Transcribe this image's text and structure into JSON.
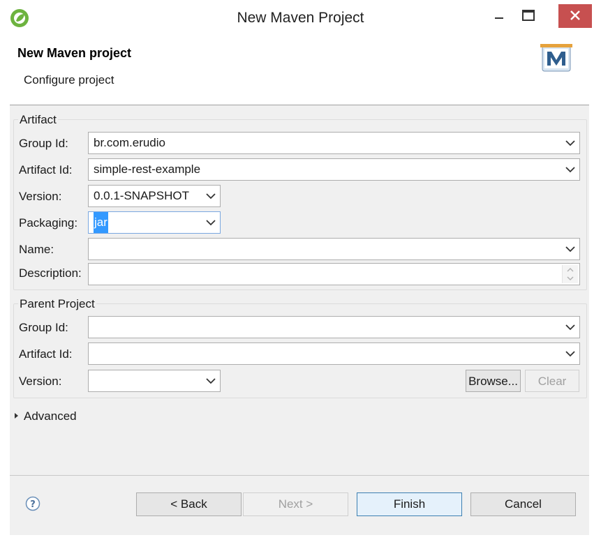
{
  "window": {
    "title": "New Maven Project"
  },
  "header": {
    "title": "New Maven project",
    "subtitle": "Configure project"
  },
  "artifact": {
    "legend": "Artifact",
    "group_id": {
      "label": "Group Id:",
      "value": "br.com.erudio"
    },
    "artifact_id": {
      "label": "Artifact Id:",
      "value": "simple-rest-example"
    },
    "version": {
      "label": "Version:",
      "value": "0.0.1-SNAPSHOT"
    },
    "packaging": {
      "label": "Packaging:",
      "value": "jar"
    },
    "name": {
      "label": "Name:",
      "value": ""
    },
    "description": {
      "label": "Description:",
      "value": ""
    }
  },
  "parent": {
    "legend": "Parent Project",
    "group_id": {
      "label": "Group Id:",
      "value": ""
    },
    "artifact_id": {
      "label": "Artifact Id:",
      "value": ""
    },
    "version": {
      "label": "Version:",
      "value": ""
    },
    "browse_label": "Browse...",
    "clear_label": "Clear"
  },
  "advanced": {
    "label": "Advanced"
  },
  "footer": {
    "back_label": "< Back",
    "next_label": "Next >",
    "finish_label": "Finish",
    "cancel_label": "Cancel"
  },
  "colors": {
    "close_button": "#c75050",
    "selection": "#3399ff",
    "dialog_bg": "#f0f0f0"
  },
  "icons": [
    "spring-app-icon",
    "minimize-icon",
    "maximize-icon",
    "close-icon",
    "maven-logo",
    "help-icon",
    "chevron-down-icon",
    "expand-arrow-icon"
  ]
}
